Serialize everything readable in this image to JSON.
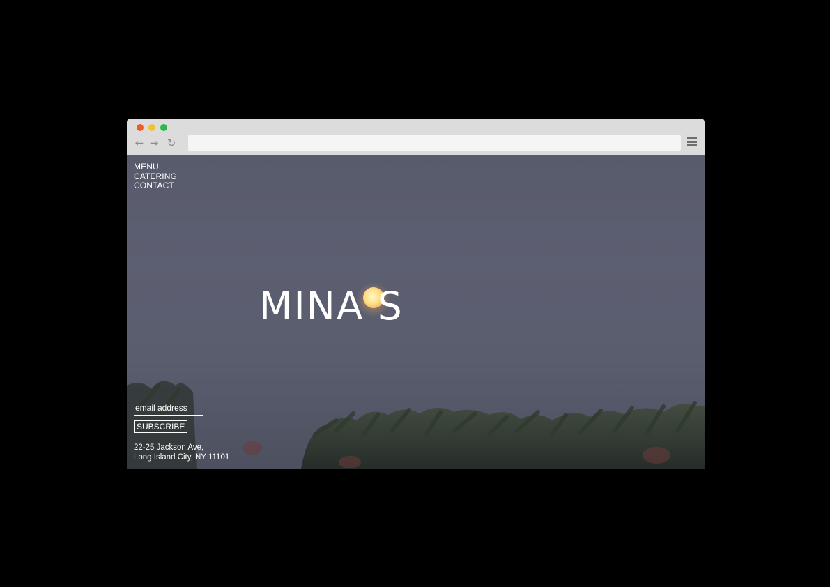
{
  "browser": {
    "traffic_lights": {
      "close_color": "#f25a23",
      "minimize_color": "#f4c12a",
      "maximize_color": "#2cb94a"
    },
    "back_icon": "←",
    "forward_icon": "→",
    "reload_icon": "↻",
    "address_value": "",
    "menu_icon": "hamburger-menu-icon"
  },
  "site": {
    "nav": [
      {
        "label": "MENU"
      },
      {
        "label": "CATERING"
      },
      {
        "label": "CONTACT"
      }
    ],
    "logo": "MINA S",
    "subscribe": {
      "placeholder": "email address",
      "button_label": "SUBSCRIBE"
    },
    "address": {
      "line1": "22-25 Jackson Ave,",
      "line2": "Long Island City, NY 11101"
    }
  },
  "colors": {
    "sky": "#5a5d6e",
    "moon": "#ffe08a",
    "text": "#ffffff"
  }
}
